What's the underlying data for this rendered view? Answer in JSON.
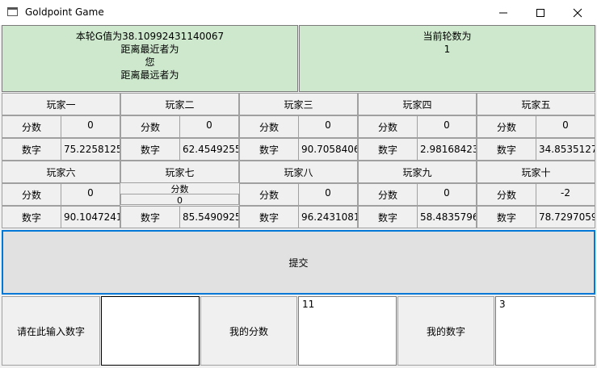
{
  "window": {
    "title": "Goldpoint Game"
  },
  "info": {
    "g_value": "本轮G值为38.10992431140067",
    "closest_label": "距离最近者为",
    "closest_value": "您",
    "farthest_label": "距离最远者为",
    "round_label": "当前轮数为",
    "round_value": "1"
  },
  "labels": {
    "score": "分数",
    "number": "数字"
  },
  "players": [
    {
      "name": "玩家一",
      "score": "0",
      "number": "75.2258125"
    },
    {
      "name": "玩家二",
      "score": "0",
      "number": "62.4549255"
    },
    {
      "name": "玩家三",
      "score": "0",
      "number": "90.7058406"
    },
    {
      "name": "玩家四",
      "score": "0",
      "number": "2.98168423"
    },
    {
      "name": "玩家五",
      "score": "0",
      "number": "34.8535127"
    },
    {
      "name": "玩家六",
      "score": "0",
      "number": "90.1047241"
    },
    {
      "name": "玩家七",
      "score": "0",
      "number": "85.5490925"
    },
    {
      "name": "玩家八",
      "score": "0",
      "number": "96.2431081"
    },
    {
      "name": "玩家九",
      "score": "0",
      "number": "58.4835796"
    },
    {
      "name": "玩家十",
      "score": "-2",
      "number": "78.7297059"
    }
  ],
  "submit_label": "提交",
  "bottom": {
    "input_prompt": "请在此输入数字",
    "input_value": "",
    "my_score_label": "我的分数",
    "my_score_value": "11",
    "my_number_label": "我的数字",
    "my_number_value": "3"
  }
}
